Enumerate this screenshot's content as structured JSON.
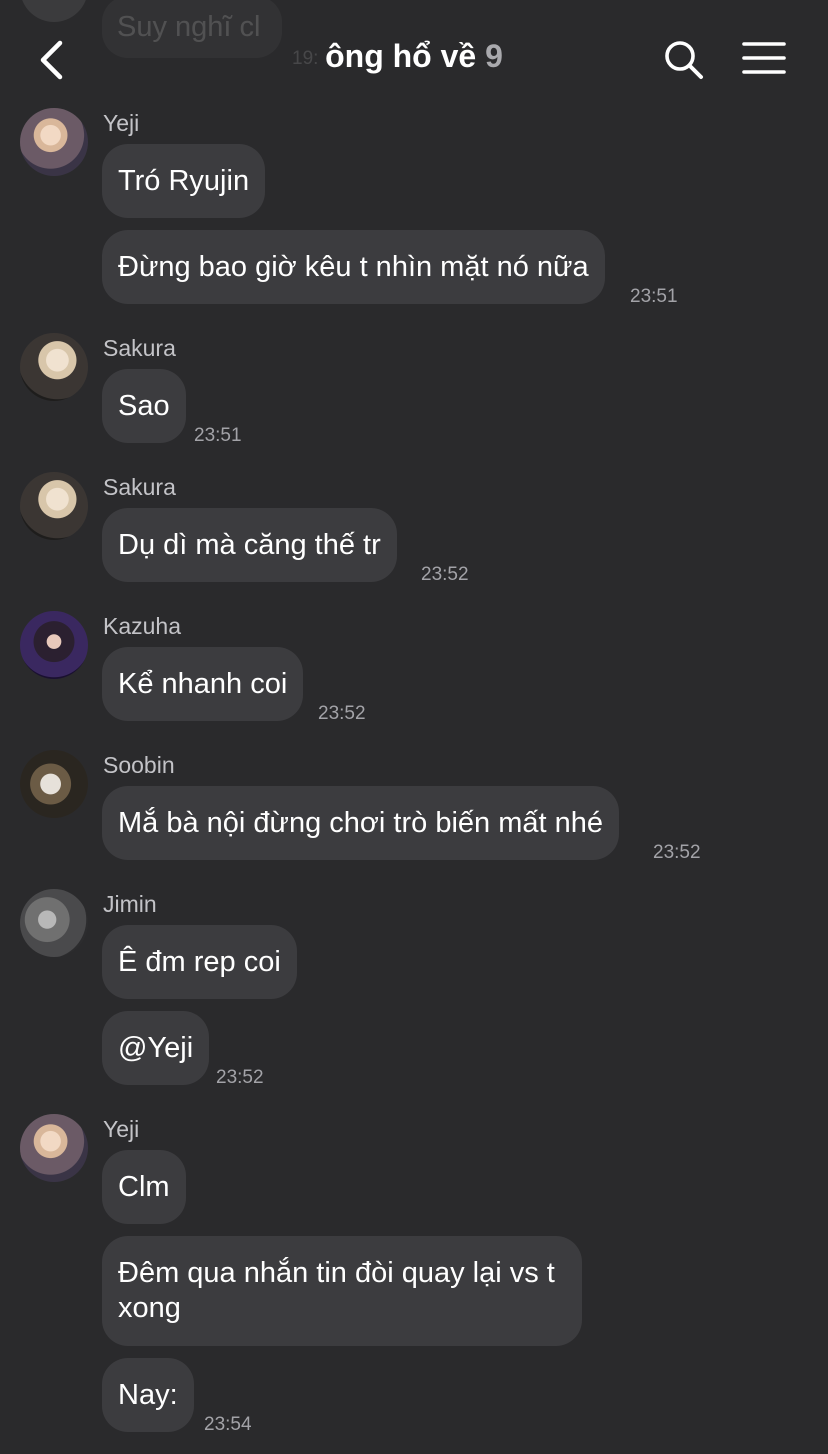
{
  "header": {
    "title": "ông hổ về",
    "member_count": "9",
    "previous_preview": "Suy nghĩ cl",
    "previous_time": "19:"
  },
  "icons": {
    "back": "chevron-left-icon",
    "search": "search-icon",
    "menu": "hamburger-menu-icon"
  },
  "colors": {
    "background": "#2a2a2c",
    "bubble": "#3c3c3f",
    "text": "#ffffff",
    "muted": "#a3a3a8"
  },
  "messages": [
    {
      "sender": "Yeji",
      "texts": [
        "Tró Ryujin",
        "Đừng bao giờ kêu t nhìn mặt nó nữa"
      ],
      "time": "23:51"
    },
    {
      "sender": "Sakura",
      "texts": [
        "Sao"
      ],
      "time": "23:51"
    },
    {
      "sender": "Sakura",
      "texts": [
        "Dụ dì mà căng thế tr"
      ],
      "time": "23:52"
    },
    {
      "sender": "Kazuha",
      "texts": [
        "Kể nhanh coi"
      ],
      "time": "23:52"
    },
    {
      "sender": "Soobin",
      "texts": [
        "Mắ bà nội đừng chơi trò biến mất nhé"
      ],
      "time": "23:52"
    },
    {
      "sender": "Jimin",
      "texts": [
        "Ê đm rep coi",
        "@Yeji"
      ],
      "time": "23:52"
    },
    {
      "sender": "Yeji",
      "texts": [
        "Clm",
        "Đêm qua nhắn tin đòi quay lại vs t xong",
        "Nay:"
      ],
      "time": "23:54"
    }
  ]
}
